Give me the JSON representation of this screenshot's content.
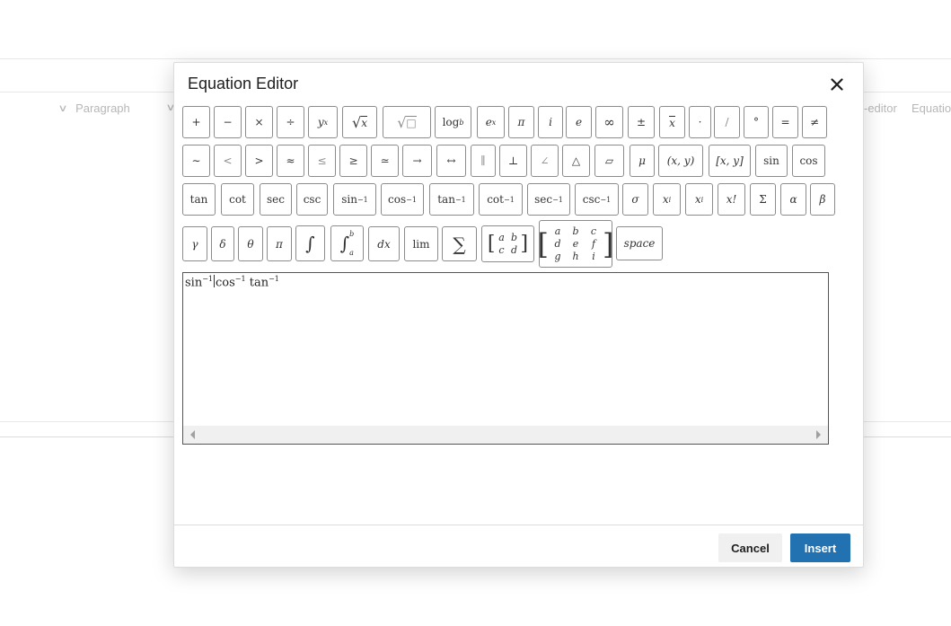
{
  "background": {
    "paragraph_label": "Paragraph",
    "right_text_1": "-editor",
    "right_text_2": "Equatio"
  },
  "modal": {
    "title": "Equation Editor",
    "cancel_label": "Cancel",
    "insert_label": "Insert"
  },
  "keys": {
    "plus": "+",
    "minus": "−",
    "times": "×",
    "divide": "÷",
    "power_base": "y",
    "power_exp": "x",
    "sqrt_sym": "√",
    "sqrt_arg": "x",
    "nthroot_sym": "√",
    "nthroot_arg": "□",
    "log": "log",
    "log_sub": "b",
    "exp_base": "e",
    "exp_sup": "x",
    "pi": "π",
    "i": "i",
    "e": "e",
    "infinity": "∞",
    "plusminus": "±",
    "bar": "x",
    "cdot": "·",
    "slash": "/",
    "degree": "°",
    "equals": "=",
    "notequal": "≠",
    "tilde": "∼",
    "less": "<",
    "greater": ">",
    "approx": "≈",
    "leq": "≤",
    "geq": "≥",
    "simeq": "≃",
    "rightarrow": "→",
    "leftrightarrow": "↔",
    "parallel": "∥",
    "perp": "⊥",
    "angle": "∠",
    "triangle": "△",
    "parallelogram": "▱",
    "mu": "μ",
    "interval_open": "(x, y)",
    "interval_closed": "[x, y]",
    "sin": "sin",
    "cos": "cos",
    "tan": "tan",
    "cot": "cot",
    "sec": "sec",
    "csc": "csc",
    "arcsin": "sin",
    "arccos": "cos",
    "arctan": "tan",
    "arccot": "cot",
    "arcsec": "sec",
    "arccsc": "csc",
    "inv_sup": "−1",
    "sigma": "σ",
    "sup_base": "x",
    "sup_exp": "i",
    "sub_base": "x",
    "sub_idx": "i",
    "factorial": "x!",
    "Sigma": "Σ",
    "alpha": "α",
    "beta": "β",
    "gamma": "γ",
    "delta": "δ",
    "theta": "θ",
    "pi2": "π",
    "integral": "∫",
    "def_integral": "∫",
    "def_int_upper": "b",
    "def_int_lower": "a",
    "dx": "dx",
    "lim": "lim",
    "sum": "∑",
    "matrix2": [
      "a",
      "b",
      "c",
      "d"
    ],
    "matrix3": [
      "a",
      "b",
      "c",
      "d",
      "e",
      "f",
      "g",
      "h",
      "i"
    ],
    "space": "space"
  },
  "equation": {
    "t1": "sin",
    "t1_sup": "−1",
    "t2": "cos",
    "t2_sup": "−1",
    "t3": "tan",
    "t3_sup": "−1"
  }
}
